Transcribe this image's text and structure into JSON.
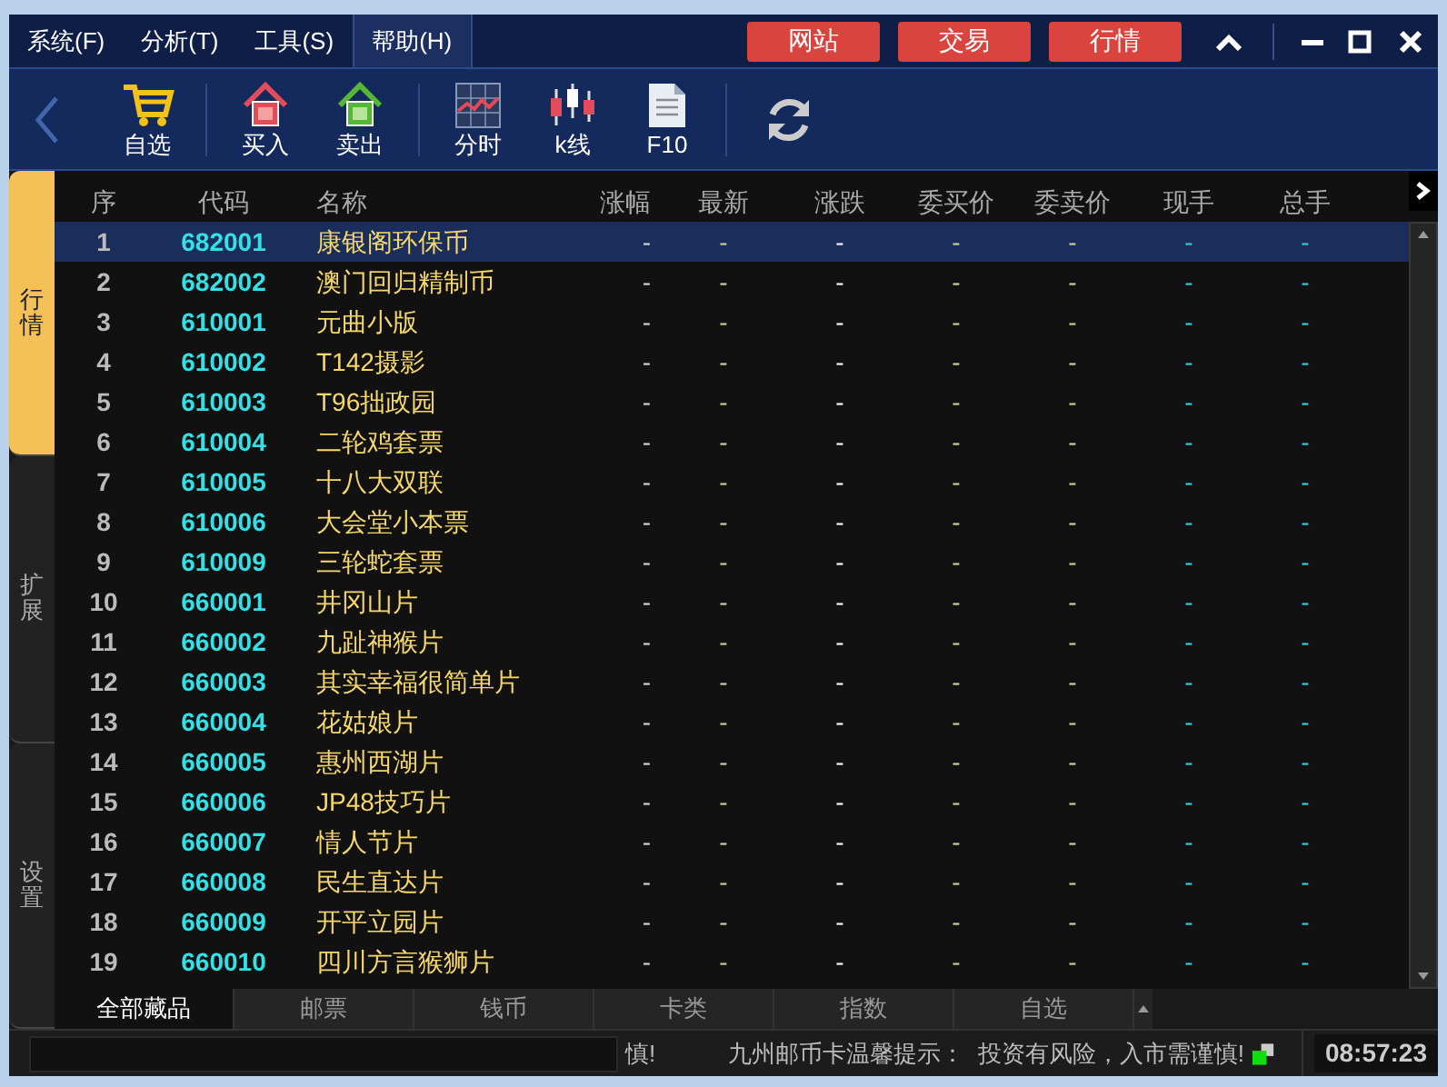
{
  "menu": [
    {
      "label": "系统(F)",
      "selected": false
    },
    {
      "label": "分析(T)",
      "selected": false
    },
    {
      "label": "工具(S)",
      "selected": false
    },
    {
      "label": "帮助(H)",
      "selected": true
    }
  ],
  "title_buttons": [
    "网站",
    "交易",
    "行情"
  ],
  "toolbar": [
    {
      "kind": "cart",
      "label": "自选"
    },
    {
      "kind": "buy",
      "label": "买入"
    },
    {
      "kind": "sell",
      "label": "卖出"
    },
    {
      "kind": "timeshare",
      "label": "分时"
    },
    {
      "kind": "kline",
      "label": "k线"
    },
    {
      "kind": "doc",
      "label": "F10"
    },
    {
      "kind": "refresh"
    }
  ],
  "side_tabs": [
    {
      "label": "行情",
      "selected": true
    },
    {
      "label": "扩展",
      "selected": false
    },
    {
      "label": "设置",
      "selected": false
    }
  ],
  "table": {
    "columns": [
      "序",
      "代码",
      "名称",
      "涨幅",
      "最新",
      "涨跌",
      "委买价",
      "委卖价",
      "现手",
      "总手"
    ],
    "rows": [
      {
        "selected": true,
        "cells": [
          "1",
          "682001",
          "康银阁环保币",
          "-",
          "-",
          "-",
          "-",
          "-",
          "-",
          "-"
        ]
      },
      {
        "selected": false,
        "cells": [
          "2",
          "682002",
          "澳门回归精制币",
          "-",
          "-",
          "-",
          "-",
          "-",
          "-",
          "-"
        ]
      },
      {
        "selected": false,
        "cells": [
          "3",
          "610001",
          "元曲小版",
          "-",
          "-",
          "-",
          "-",
          "-",
          "-",
          "-"
        ]
      },
      {
        "selected": false,
        "cells": [
          "4",
          "610002",
          "T142摄影",
          "-",
          "-",
          "-",
          "-",
          "-",
          "-",
          "-"
        ]
      },
      {
        "selected": false,
        "cells": [
          "5",
          "610003",
          "T96拙政园",
          "-",
          "-",
          "-",
          "-",
          "-",
          "-",
          "-"
        ]
      },
      {
        "selected": false,
        "cells": [
          "6",
          "610004",
          "二轮鸡套票",
          "-",
          "-",
          "-",
          "-",
          "-",
          "-",
          "-"
        ]
      },
      {
        "selected": false,
        "cells": [
          "7",
          "610005",
          "十八大双联",
          "-",
          "-",
          "-",
          "-",
          "-",
          "-",
          "-"
        ]
      },
      {
        "selected": false,
        "cells": [
          "8",
          "610006",
          "大会堂小本票",
          "-",
          "-",
          "-",
          "-",
          "-",
          "-",
          "-"
        ]
      },
      {
        "selected": false,
        "cells": [
          "9",
          "610009",
          "三轮蛇套票",
          "-",
          "-",
          "-",
          "-",
          "-",
          "-",
          "-"
        ]
      },
      {
        "selected": false,
        "cells": [
          "10",
          "660001",
          "井冈山片",
          "-",
          "-",
          "-",
          "-",
          "-",
          "-",
          "-"
        ]
      },
      {
        "selected": false,
        "cells": [
          "11",
          "660002",
          "九趾神猴片",
          "-",
          "-",
          "-",
          "-",
          "-",
          "-",
          "-"
        ]
      },
      {
        "selected": false,
        "cells": [
          "12",
          "660003",
          "其实幸福很简单片",
          "-",
          "-",
          "-",
          "-",
          "-",
          "-",
          "-"
        ]
      },
      {
        "selected": false,
        "cells": [
          "13",
          "660004",
          "花姑娘片",
          "-",
          "-",
          "-",
          "-",
          "-",
          "-",
          "-"
        ]
      },
      {
        "selected": false,
        "cells": [
          "14",
          "660005",
          "惠州西湖片",
          "-",
          "-",
          "-",
          "-",
          "-",
          "-",
          "-"
        ]
      },
      {
        "selected": false,
        "cells": [
          "15",
          "660006",
          "JP48技巧片",
          "-",
          "-",
          "-",
          "-",
          "-",
          "-",
          "-"
        ]
      },
      {
        "selected": false,
        "cells": [
          "16",
          "660007",
          "情人节片",
          "-",
          "-",
          "-",
          "-",
          "-",
          "-",
          "-"
        ]
      },
      {
        "selected": false,
        "cells": [
          "17",
          "660008",
          "民生直达片",
          "-",
          "-",
          "-",
          "-",
          "-",
          "-",
          "-"
        ]
      },
      {
        "selected": false,
        "cells": [
          "18",
          "660009",
          "开平立园片",
          "-",
          "-",
          "-",
          "-",
          "-",
          "-",
          "-"
        ]
      },
      {
        "selected": false,
        "cells": [
          "19",
          "660010",
          "四川方言猴狮片",
          "-",
          "-",
          "-",
          "-",
          "-",
          "-",
          "-"
        ]
      }
    ]
  },
  "bottom_tabs": [
    {
      "label": "全部藏品",
      "selected": true
    },
    {
      "label": "邮票",
      "selected": false
    },
    {
      "label": "钱币",
      "selected": false
    },
    {
      "label": "卡类",
      "selected": false
    },
    {
      "label": "指数",
      "selected": false
    },
    {
      "label": "自选",
      "selected": false
    }
  ],
  "status_bar": {
    "ticker": "慎!",
    "notice": "九州邮币卡温馨提示：  投资有风险，入市需谨慎!",
    "time": "08:57:23"
  }
}
